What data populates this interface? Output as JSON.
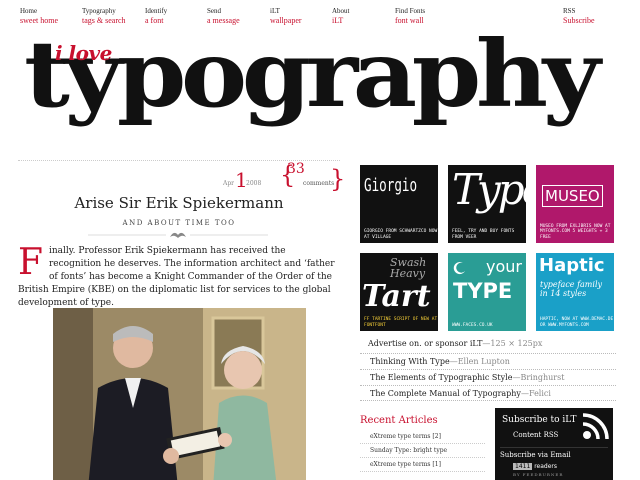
{
  "nav": [
    {
      "title": "Home",
      "sub": "sweet home"
    },
    {
      "title": "Typography",
      "sub": "tags & search"
    },
    {
      "title": "Identify",
      "sub": "a font"
    },
    {
      "title": "Send",
      "sub": "a message"
    },
    {
      "title": "iLT",
      "sub": "wallpaper"
    },
    {
      "title": "About",
      "sub": "iLT"
    },
    {
      "title": "Find Fonts",
      "sub": "font wall"
    },
    {
      "title": "RSS",
      "sub": "Subscribe"
    }
  ],
  "logo": {
    "small": "i love",
    "big": "typography"
  },
  "post": {
    "month": "Apr",
    "day": "1",
    "year": "2008",
    "comment_count": "33",
    "comment_label": "comments",
    "title": "Arise Sir Erik Spiekermann",
    "subtitle": "AND ABOUT TIME TOO",
    "dropcap": "F",
    "body": "inally. Professor Erik Spiekermann has received the recognition he deserves. The information architect and ‘father of fonts’ has become a Knight Commander of the Order of the British Empire (KBE) on the diplomatic list for services to the global development of type."
  },
  "ads": [
    {
      "word": "Giorgio",
      "caption": "GIORGIO FROM SCHWARTZCO NOW AT VILLAGE"
    },
    {
      "word": "Type",
      "caption": "FEEL, TRY AND BUY FONTS FROM VEER"
    },
    {
      "word": "MUSEO",
      "caption": "MUSEO FROM EXLJBRIS NOW AT MYFONTS.COM 5 WEIGHTS + 3 FREE"
    },
    {
      "word": "Tart",
      "word2": "Swash Heavy",
      "caption": "FF TARTINE SCRIPT OF NEW AT FONTFONT"
    },
    {
      "word": "your",
      "word2": "TYPE",
      "caption": "WWW.FACES.CO.UK"
    },
    {
      "word": "Haptic",
      "word2": "typeface family in 14 styles",
      "caption": "HAPTIC, NOW AT WWW.DEMAC.DE OR WWW.MYFONTS.COM"
    }
  ],
  "advertise": {
    "text": "Advertise on. or sponsor iLT",
    "size": "—125 × 125px"
  },
  "books": [
    {
      "title": "Thinking With Type",
      "author": "—Ellen Lupton"
    },
    {
      "title": "The Elements of Typographic Style",
      "author": "—Bringhurst"
    },
    {
      "title": "The Complete Manual of Typography",
      "author": "—Felici"
    }
  ],
  "recent": {
    "heading": "Recent Articles",
    "items": [
      "eXtreme type terms [2]",
      "Sunday Type: bright type",
      "eXtreme type terms [1]"
    ]
  },
  "subscribe": {
    "heading": "Subscribe to iLT",
    "content_rss": "Content RSS",
    "email": "Subscribe via Email",
    "readers_count": "1411",
    "readers_label": "readers",
    "feedburner": "BY FEEDBURNER"
  },
  "colors": {
    "accent": "#c8102e",
    "teal": "#2a9d95",
    "magenta": "#b0186b",
    "cyan": "#1aa0c8"
  }
}
